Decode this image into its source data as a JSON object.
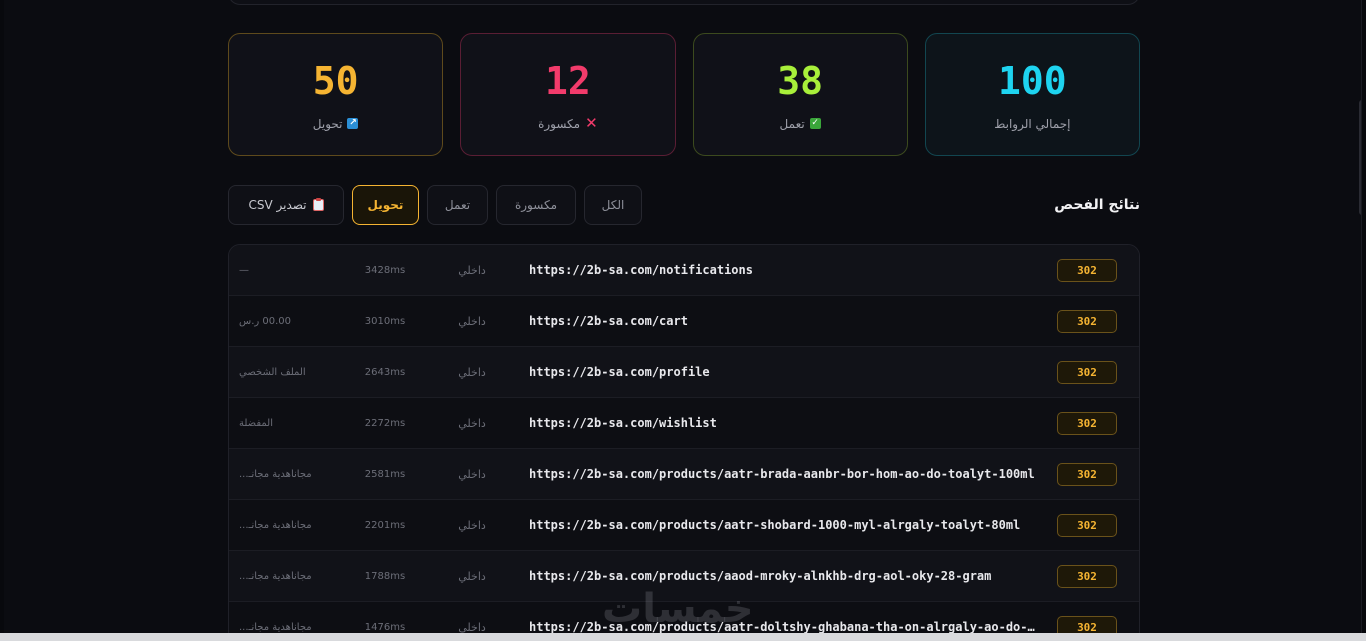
{
  "stats": [
    {
      "key": "redirect",
      "value": "50",
      "label": "تحويل",
      "icon": "arrow-up-right-icon"
    },
    {
      "key": "broken",
      "value": "12",
      "label": "مكسورة",
      "icon": "x-icon"
    },
    {
      "key": "working",
      "value": "38",
      "label": "تعمل",
      "icon": "check-icon"
    },
    {
      "key": "total",
      "value": "100",
      "label": "إجمالي الروابط"
    }
  ],
  "results": {
    "title": "نتائج الفحص",
    "export_label": "تصدير CSV",
    "filters": {
      "redirect": "تحويل",
      "working": "تعمل",
      "broken": "مكسورة",
      "all": "الكل"
    },
    "active_filter": "redirect"
  },
  "rows": [
    {
      "code": "302",
      "url": "https://2b-sa.com/notifications",
      "type": "داخلي",
      "time": "3428ms",
      "title": "—"
    },
    {
      "code": "302",
      "url": "https://2b-sa.com/cart",
      "type": "داخلي",
      "time": "3010ms",
      "title": "00.00 ر.س"
    },
    {
      "code": "302",
      "url": "https://2b-sa.com/profile",
      "type": "داخلي",
      "time": "2643ms",
      "title": "الملف الشخصي"
    },
    {
      "code": "302",
      "url": "https://2b-sa.com/wishlist",
      "type": "داخلي",
      "time": "2272ms",
      "title": "المفضلة"
    },
    {
      "code": "302",
      "url": "https://2b-sa.com/products/aatr-brada-aanbr-bor-hom-ao-do-toalyt-100ml",
      "type": "داخلي",
      "time": "2581ms",
      "title": "مجاناًهدية مجانـ..."
    },
    {
      "code": "302",
      "url": "https://2b-sa.com/products/aatr-shobard-1000-myl-alrgaly-toalyt-80ml",
      "type": "داخلي",
      "time": "2201ms",
      "title": "مجاناًهدية مجانـ..."
    },
    {
      "code": "302",
      "url": "https://2b-sa.com/products/aaod-mroky-alnkhb-drg-aol-oky-28-gram",
      "type": "داخلي",
      "time": "1788ms",
      "title": "مجاناًهدية مجانـ..."
    },
    {
      "code": "302",
      "url": "https://2b-sa.com/products/aatr-doltshy-ghabana-tha-on-alrgaly-ao-do-b...",
      "type": "داخلي",
      "time": "1476ms",
      "title": "مجاناًهدية مجانـ..."
    }
  ],
  "watermark": "خمسات",
  "colors": {
    "redirect": "#f5b432",
    "broken": "#f23b6b",
    "working": "#a8ef3a",
    "total": "#1ed4f0"
  }
}
